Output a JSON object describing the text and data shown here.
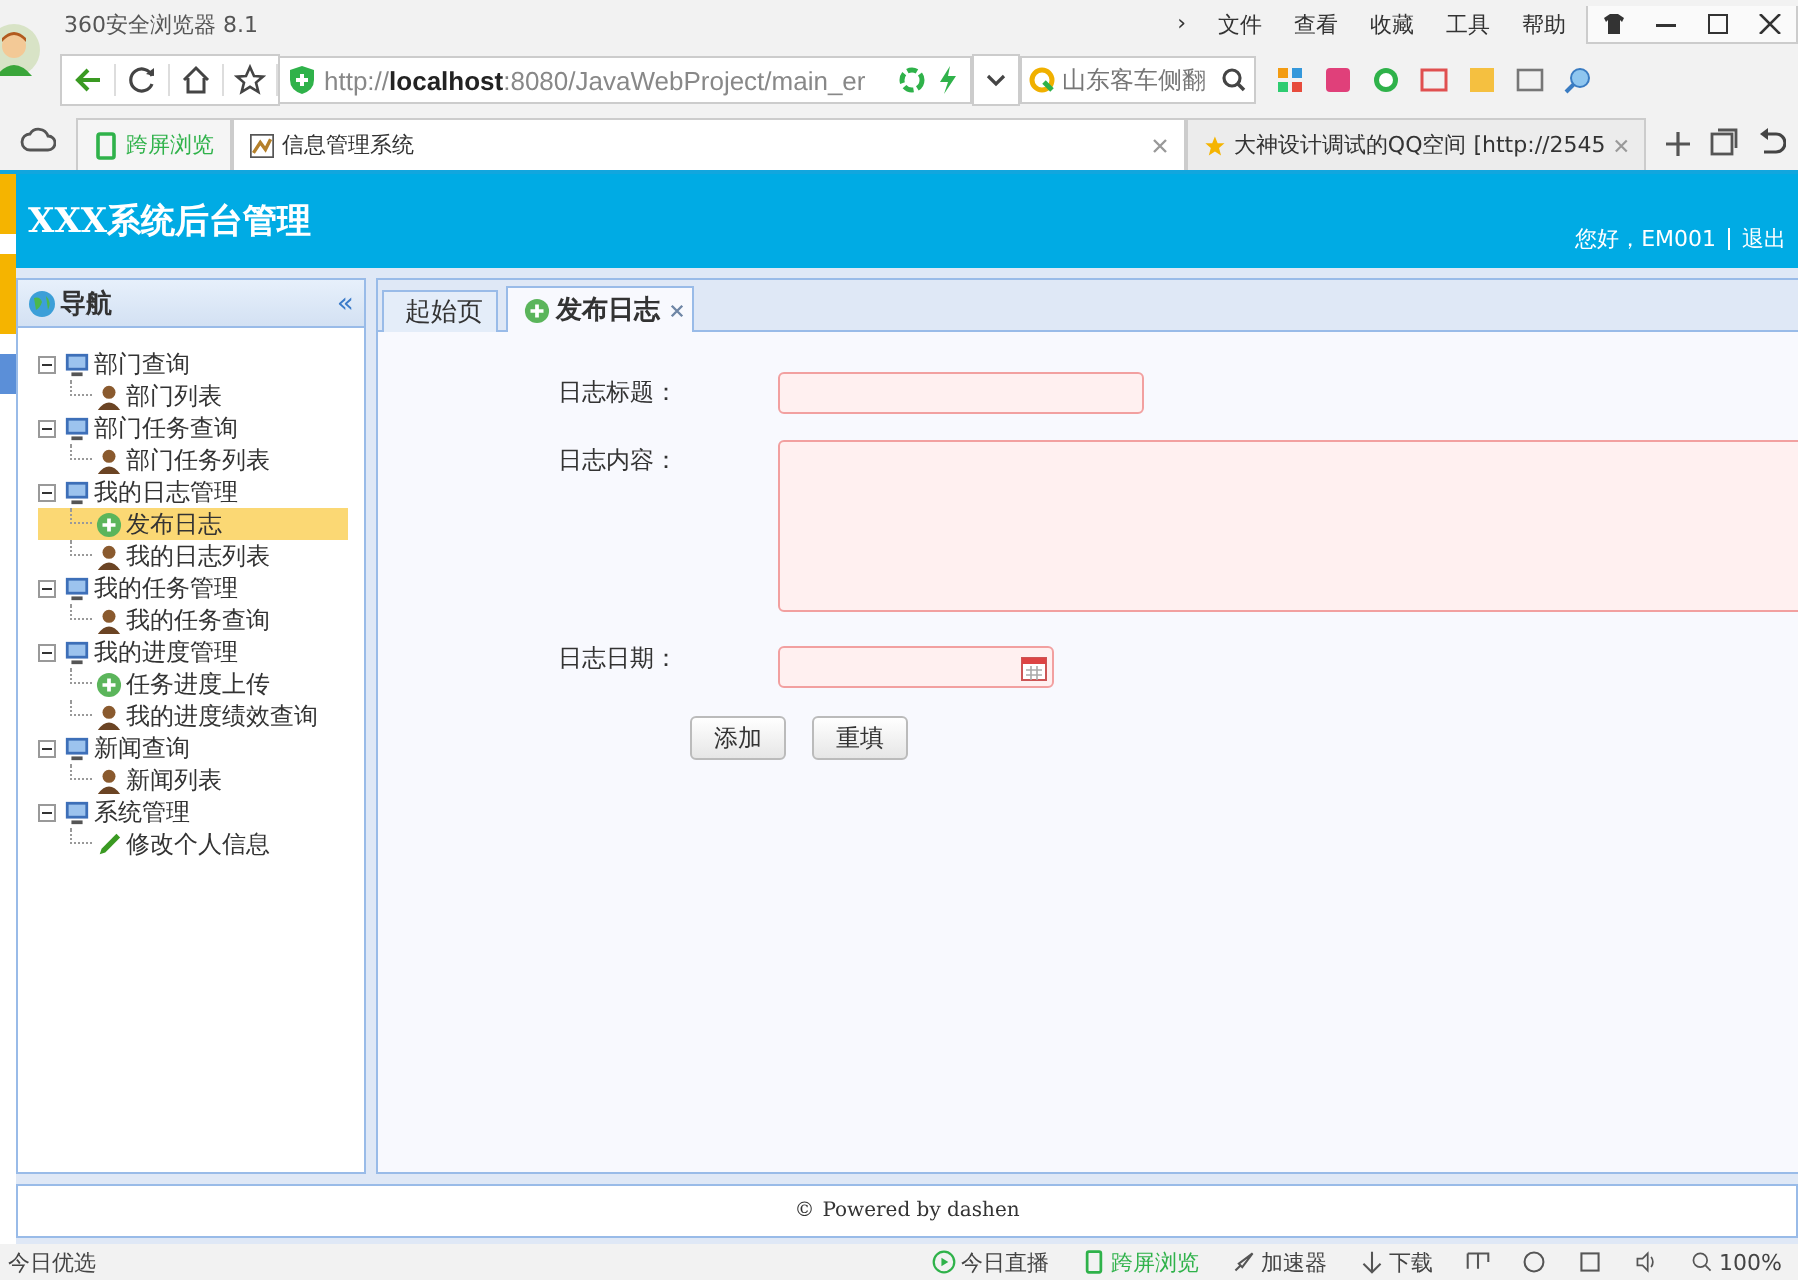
{
  "browser": {
    "title": "360安全浏览器 8.1",
    "menu": [
      "›",
      "文件",
      "查看",
      "收藏",
      "工具",
      "帮助"
    ],
    "address": "http://**localhost**:8080/JavaWebProject/main_er",
    "search": "山东客车侧翻",
    "tabs": [
      {
        "label": "跨屏浏览",
        "kind": "phone",
        "selected": false,
        "closable": false
      },
      {
        "label": "信息管理系统",
        "kind": "page",
        "selected": true,
        "closable": true
      },
      {
        "label": "大神设计调试的QQ空间 [http://2545",
        "kind": "star",
        "selected": false,
        "closable": true
      }
    ],
    "status_left": "今日优选",
    "status_items": [
      {
        "label": "今日直播",
        "kind": "play"
      },
      {
        "label": "跨屏浏览",
        "kind": "phone"
      },
      {
        "label": "加速器",
        "kind": "rocket"
      },
      {
        "label": "下载",
        "kind": "download"
      }
    ],
    "zoom": "100%"
  },
  "app": {
    "title": "XXX系统后台管理",
    "greeting": "您好，EM001",
    "logout": "退出"
  },
  "nav": {
    "title": "导航",
    "collapse": "«",
    "tree": [
      {
        "label": "部门查询",
        "expanded": true,
        "children": [
          {
            "label": "部门列表",
            "kind": "user",
            "selected": false
          }
        ]
      },
      {
        "label": "部门任务查询",
        "expanded": true,
        "children": [
          {
            "label": "部门任务列表",
            "kind": "user",
            "selected": false
          }
        ]
      },
      {
        "label": "我的日志管理",
        "expanded": true,
        "children": [
          {
            "label": "发布日志",
            "kind": "add",
            "selected": true
          },
          {
            "label": "我的日志列表",
            "kind": "user",
            "selected": false
          }
        ]
      },
      {
        "label": "我的任务管理",
        "expanded": true,
        "children": [
          {
            "label": "我的任务查询",
            "kind": "user",
            "selected": false
          }
        ]
      },
      {
        "label": "我的进度管理",
        "expanded": true,
        "children": [
          {
            "label": "任务进度上传",
            "kind": "add",
            "selected": false
          },
          {
            "label": "我的进度绩效查询",
            "kind": "user",
            "selected": false
          }
        ]
      },
      {
        "label": "新闻查询",
        "expanded": true,
        "children": [
          {
            "label": "新闻列表",
            "kind": "user",
            "selected": false
          }
        ]
      },
      {
        "label": "系统管理",
        "expanded": true,
        "children": [
          {
            "label": "修改个人信息",
            "kind": "edit",
            "selected": false
          }
        ]
      }
    ]
  },
  "content_tabs": [
    {
      "label": "起始页",
      "selected": false,
      "closable": false,
      "icon": false
    },
    {
      "label": "发布日志",
      "selected": true,
      "closable": true,
      "icon": true
    }
  ],
  "form": {
    "fields": [
      {
        "label": "日志标题：",
        "kind": "text"
      },
      {
        "label": "日志内容：",
        "kind": "textarea"
      },
      {
        "label": "日志日期：",
        "kind": "date"
      }
    ],
    "buttons": [
      "添加",
      "重填"
    ]
  },
  "footer": {
    "copyright": "©",
    "text": "Powered by dashen"
  }
}
